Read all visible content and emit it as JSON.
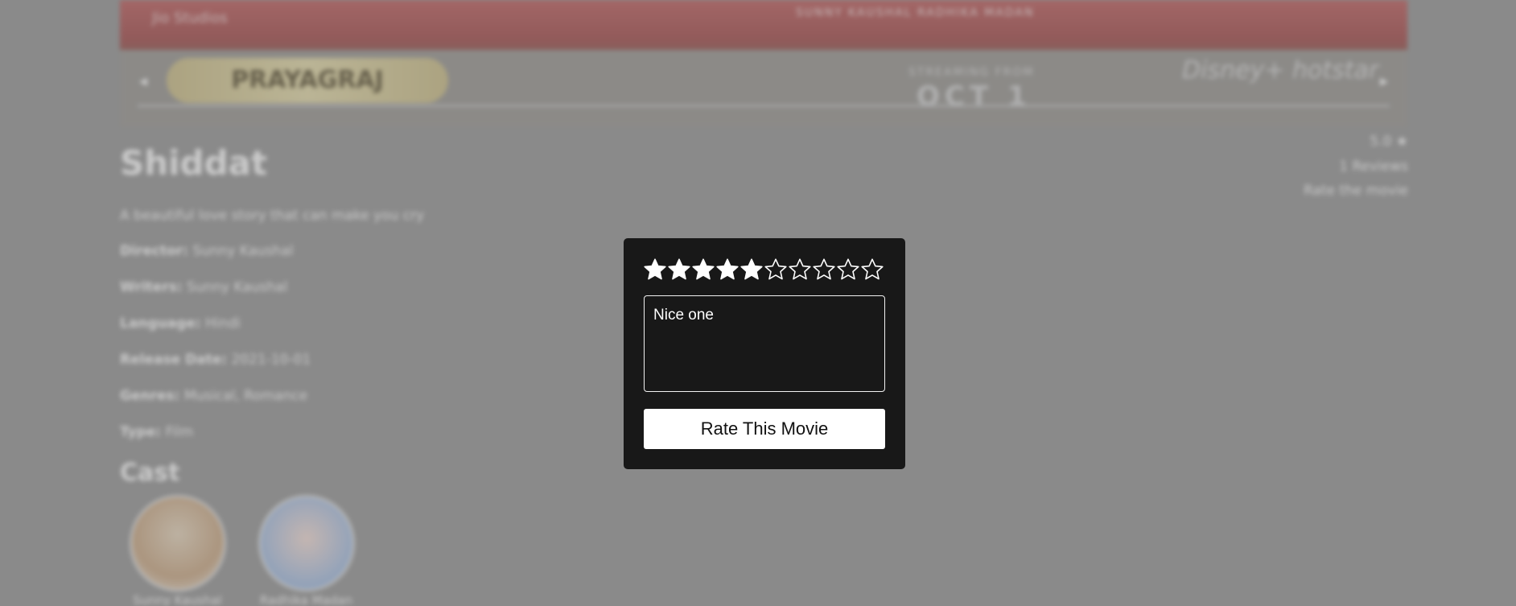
{
  "background": {
    "hero": {
      "badge_text": "PRAYAGRAJ",
      "streaming_text": "STREAMING FROM",
      "date_text": "OCT 1",
      "logo_text": "Disney+ hotstar",
      "top_logo_text": "Jio Studios",
      "top_text": "SUNNY KAUSHAL  RADHIKA MADAN"
    },
    "movie": {
      "title": "Shiddat",
      "tagline": "A beautiful love story that can make you cry",
      "director_label": "Director:",
      "director_value": "Sunny Kaushal",
      "writers_label": "Writers:",
      "writers_value": "Sunny Kaushal",
      "language_label": "Language:",
      "language_value": "Hindi",
      "release_label": "Release Date:",
      "release_value": "2021-10-01",
      "genres_label": "Genres:",
      "genres_value": "Musical, Romance",
      "type_label": "Type:",
      "type_value": "Film",
      "cast_heading": "Cast",
      "cast": [
        {
          "name": "Sunny Kaushal"
        },
        {
          "name": "Radhika Madan"
        }
      ]
    },
    "rating_side": {
      "score": "5.0 ★",
      "reviews": "1 Reviews",
      "rate_link": "Rate the movie"
    }
  },
  "modal": {
    "rating": {
      "value": 5,
      "max": 10
    },
    "review_text": "Nice one",
    "submit_label": "Rate This Movie",
    "colors": {
      "modal_bg": "#181818",
      "star": "#ffffff",
      "button_bg": "#ffffff"
    }
  }
}
